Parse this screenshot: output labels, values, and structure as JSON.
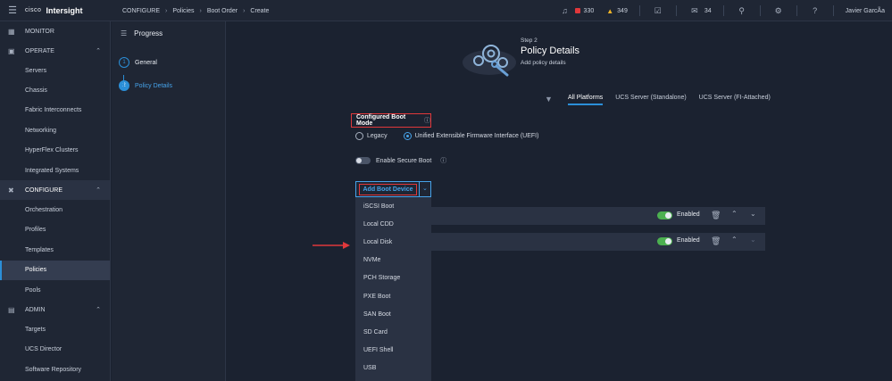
{
  "topbar": {
    "menu_icon": "hamburger-icon",
    "brand_mark": "cisco",
    "product": "Intersight",
    "breadcrumbs": [
      "CONFIGURE",
      "Policies",
      "Boot Order",
      "Create"
    ],
    "alerts": {
      "critical_count": "330",
      "warning_count": "349"
    },
    "announcements_count": "34",
    "user": "Javier GarcÃ­a"
  },
  "nav": {
    "sections": [
      {
        "label": "MONITOR",
        "icon": "monitor-icon",
        "items": []
      },
      {
        "label": "OPERATE",
        "icon": "operate-icon",
        "items": [
          "Servers",
          "Chassis",
          "Fabric Interconnects",
          "Networking",
          "HyperFlex Clusters",
          "Integrated Systems"
        ]
      },
      {
        "label": "CONFIGURE",
        "icon": "configure-icon",
        "items": [
          "Orchestration",
          "Profiles",
          "Templates",
          "Policies",
          "Pools"
        ]
      },
      {
        "label": "ADMIN",
        "icon": "admin-icon",
        "items": [
          "Targets",
          "UCS Director",
          "Software Repository"
        ]
      }
    ],
    "active_item": "Policies"
  },
  "progress": {
    "title": "Progress",
    "steps": [
      {
        "number": "1",
        "label": "General"
      },
      {
        "number": "2",
        "label": "Policy Details"
      }
    ]
  },
  "main": {
    "step_label": "Step 2",
    "title": "Policy Details",
    "subtitle": "Add policy details",
    "platform_tabs": [
      "All Platforms",
      "UCS Server (Standalone)",
      "UCS Server (FI-Attached)"
    ],
    "active_tab": "All Platforms",
    "boot_mode_label": "Configured Boot Mode",
    "boot_modes": [
      "Legacy",
      "Unified Extensible Firmware Interface (UEFI)"
    ],
    "selected_boot_mode": "Unified Extensible Firmware Interface (UEFI)",
    "secure_boot_label": "Enable Secure Boot",
    "secure_boot_enabled": false,
    "add_boot_device_label": "Add Boot Device",
    "boot_device_options": [
      "iSCSI Boot",
      "Local CDD",
      "Local Disk",
      "NVMe",
      "PCH Storage",
      "PXE Boot",
      "SAN Boot",
      "SD Card",
      "UEFI Shell",
      "USB"
    ],
    "device_rows": [
      {
        "status": "Enabled"
      },
      {
        "status": "Enabled"
      }
    ]
  },
  "colors": {
    "accent": "#2b8fd8",
    "highlight": "#e0383b",
    "enabled": "#4cb050"
  }
}
